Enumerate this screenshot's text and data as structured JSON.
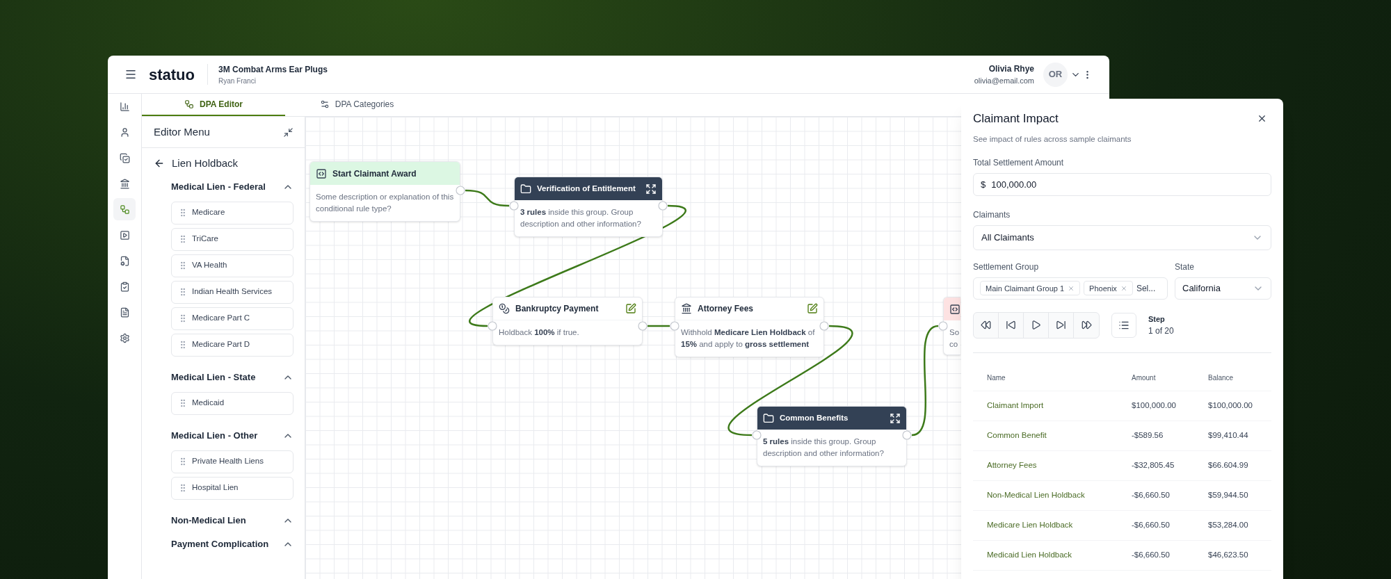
{
  "header": {
    "logo": "statuo",
    "case_title": "3M Combat Arms Ear Plugs",
    "case_subtitle": "Ryan Franci",
    "user": {
      "name": "Olivia Rhye",
      "email": "olivia@email.com",
      "initials": "OR"
    }
  },
  "rail": [
    {
      "kind": "chart",
      "selected": false
    },
    {
      "kind": "user",
      "selected": false
    },
    {
      "kind": "copy",
      "selected": false
    },
    {
      "kind": "bank",
      "selected": false
    },
    {
      "kind": "workflow",
      "selected": true
    },
    {
      "kind": "play",
      "selected": false
    },
    {
      "kind": "file-cog",
      "selected": false
    },
    {
      "kind": "clipboard",
      "selected": false
    },
    {
      "kind": "file",
      "selected": false
    },
    {
      "kind": "settings",
      "selected": false
    }
  ],
  "tabs": [
    {
      "kind": "editor",
      "label": "DPA Editor",
      "selected": true
    },
    {
      "kind": "categories",
      "label": "DPA Categories",
      "selected": false
    }
  ],
  "editor_menu": {
    "title": "Editor Menu",
    "back_label": "Lien Holdback",
    "groups": [
      {
        "title": "Medical Lien - Federal",
        "expanded": true,
        "items": [
          "Medicare",
          "TriCare",
          "VA Health",
          "Indian Health Services",
          "Medicare Part C",
          "Medicare Part D"
        ]
      },
      {
        "title": "Medical Lien - State",
        "expanded": true,
        "items": [
          "Medicaid"
        ]
      },
      {
        "title": "Medical Lien - Other",
        "expanded": true,
        "items": [
          "Private Health Liens",
          "Hospital Lien"
        ]
      },
      {
        "title": "Non-Medical Lien",
        "expanded": true
      },
      {
        "title": "Payment Complication",
        "expanded": true
      }
    ]
  },
  "canvas": {
    "nodes": [
      {
        "kind": "start",
        "title": "Start Claimant Award",
        "description": "Some description or explanation of this conditional rule type?"
      },
      {
        "kind": "group",
        "title": "Verification of Entitlement",
        "description": "**3 rules** inside this group. Group description and other information?"
      },
      {
        "kind": "rule",
        "title": "Bankruptcy Payment",
        "description": "Holdback **100%** if true."
      },
      {
        "kind": "rule",
        "title": "Attorney Fees",
        "description": "Withhold **Medicare Lien Holdback** of **15%** and apply to **gross settlement**"
      },
      {
        "kind": "group",
        "title": "Common Benefits",
        "description": "**5 rules** inside this group. Group description and other information?"
      },
      {
        "kind": "end",
        "description": "So co"
      }
    ]
  },
  "impact_panel": {
    "title": "Claimant Impact",
    "subtitle": "See impact of rules across sample claimants",
    "amount": {
      "label": "Total Settlement Amount",
      "currency": "$",
      "value": "100,000.00"
    },
    "claimants": {
      "label": "Claimants",
      "value": "All Claimants"
    },
    "settlement_group": {
      "label": "Settlement Group",
      "chips": [
        "Main Claimant Group 1",
        "Phoenix"
      ],
      "placeholder": "Sel..."
    },
    "state": {
      "label": "State",
      "value": "California"
    },
    "step": {
      "label": "Step",
      "value": "1 of 20"
    },
    "table": {
      "columns": [
        "Name",
        "Amount",
        "Balance"
      ],
      "rows": [
        [
          "Claimant Import",
          "$100,000.00",
          "$100,000.00"
        ],
        [
          "Common Benefit",
          "-$589.56",
          "$99,410.44"
        ],
        [
          "Attorney Fees",
          "-$32,805.45",
          "$66.604.99"
        ],
        [
          "Non-Medical Lien Holdback",
          "-$6,660.50",
          "$59,944.50"
        ],
        [
          "Medicare Lien Holdback",
          "-$6,660.50",
          "$53,284.00"
        ],
        [
          "Medicaid Lien Holdback",
          "-$6,660.50",
          "$46,623.50"
        ]
      ]
    }
  }
}
